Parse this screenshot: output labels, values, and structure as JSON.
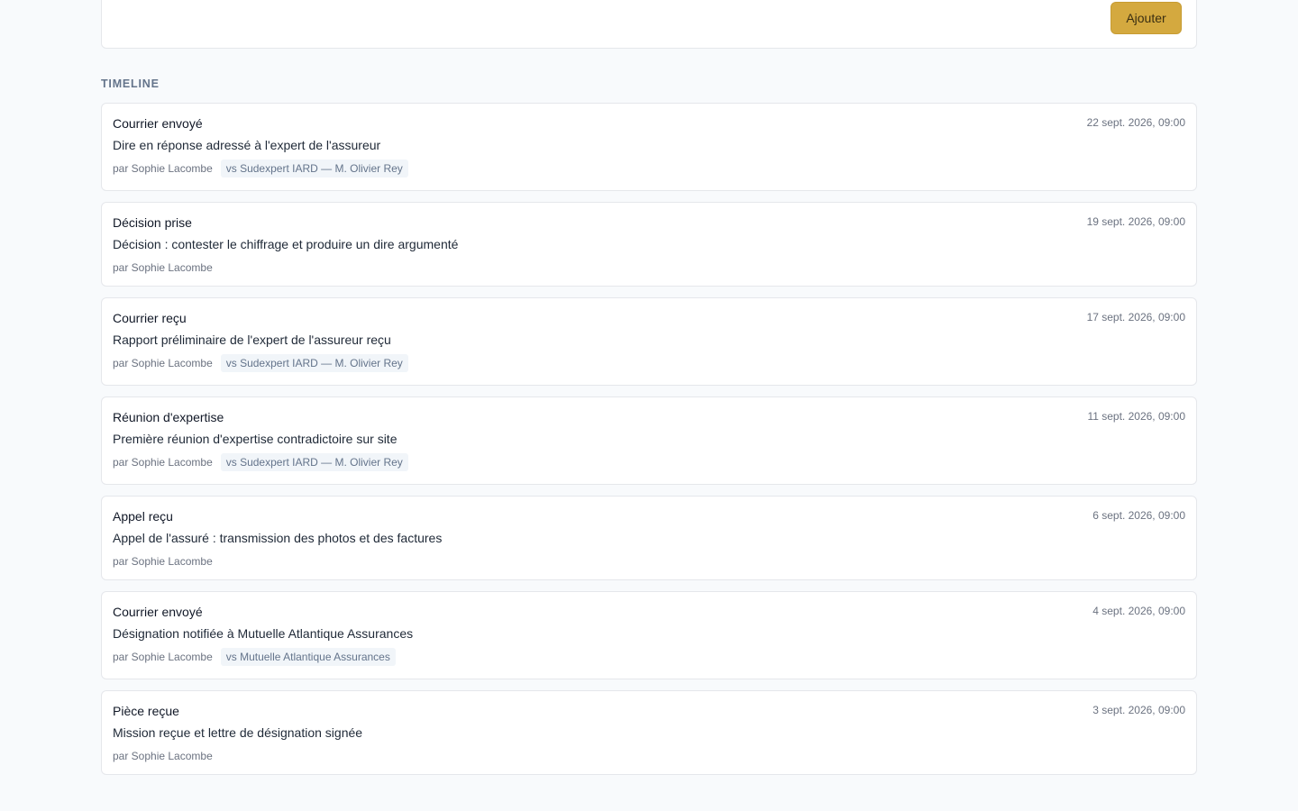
{
  "toolbar": {
    "add_label": "Ajouter"
  },
  "timeline": {
    "title": "TIMELINE",
    "entries": [
      {
        "type": "Courrier envoyé",
        "date": "22 sept. 2026, 09:00",
        "description": "Dire en réponse adressé à l'expert de l'assureur",
        "author": "par Sophie Lacombe",
        "tag": "vs Sudexpert IARD — M. Olivier Rey"
      },
      {
        "type": "Décision prise",
        "date": "19 sept. 2026, 09:00",
        "description": "Décision : contester le chiffrage et produire un dire argumenté",
        "author": "par Sophie Lacombe",
        "tag": null
      },
      {
        "type": "Courrier reçu",
        "date": "17 sept. 2026, 09:00",
        "description": "Rapport préliminaire de l'expert de l'assureur reçu",
        "author": "par Sophie Lacombe",
        "tag": "vs Sudexpert IARD — M. Olivier Rey"
      },
      {
        "type": "Réunion d'expertise",
        "date": "11 sept. 2026, 09:00",
        "description": "Première réunion d'expertise contradictoire sur site",
        "author": "par Sophie Lacombe",
        "tag": "vs Sudexpert IARD — M. Olivier Rey"
      },
      {
        "type": "Appel reçu",
        "date": "6 sept. 2026, 09:00",
        "description": "Appel de l'assuré : transmission des photos et des factures",
        "author": "par Sophie Lacombe",
        "tag": null
      },
      {
        "type": "Courrier envoyé",
        "date": "4 sept. 2026, 09:00",
        "description": "Désignation notifiée à Mutuelle Atlantique Assurances",
        "author": "par Sophie Lacombe",
        "tag": "vs Mutuelle Atlantique Assurances"
      },
      {
        "type": "Pièce reçue",
        "date": "3 sept. 2026, 09:00",
        "description": "Mission reçue et lettre de désignation signée",
        "author": "par Sophie Lacombe",
        "tag": null
      }
    ]
  }
}
